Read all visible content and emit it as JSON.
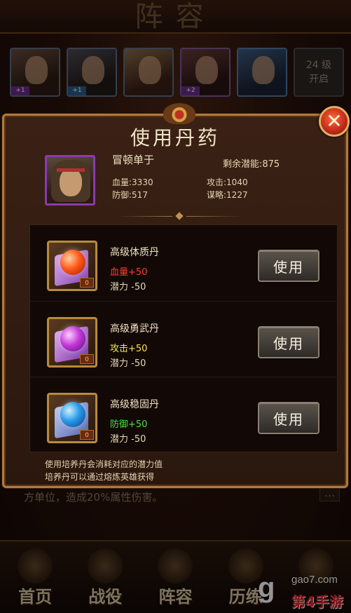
{
  "background": {
    "title": "阵容",
    "locked_slot": {
      "level": "24 级",
      "text": "开启"
    },
    "hero_badges": [
      "+1",
      "+1",
      "",
      "+2",
      ""
    ],
    "skill_desc": "方单位，造成20%属性伤害。",
    "nav": [
      {
        "label": "首页",
        "icon": "palace-icon"
      },
      {
        "label": "战役",
        "icon": "crossed-swords-icon"
      },
      {
        "label": "阵容",
        "icon": "formation-icon"
      },
      {
        "label": "历练",
        "icon": "taiji-icon"
      },
      {
        "label": "",
        "icon": "bag-icon"
      }
    ],
    "watermark": {
      "url": "gao7.com",
      "brand": "第4手游",
      "logo": "g"
    }
  },
  "dialog": {
    "title": "使用丹药",
    "hero": {
      "name": "冒顿单于",
      "remaining_potential": "剩余潜能:875",
      "hp": "血量:3330",
      "attack": "攻击:1040",
      "defense": "防御:517",
      "strategy": "谋略:1227"
    },
    "pills": [
      {
        "name": "高级体质丹",
        "stat": "血量",
        "gain": "+50",
        "cost": "潜力 -50",
        "count": "0",
        "button": "使用",
        "color": "#ff3b2a",
        "orb": "#ff5a1a"
      },
      {
        "name": "高级勇武丹",
        "stat": "攻击",
        "gain": "+50",
        "cost": "潜力 -50",
        "count": "0",
        "button": "使用",
        "color": "#ffe14a",
        "orb": "#c43ad8"
      },
      {
        "name": "高级稳固丹",
        "stat": "防御",
        "gain": "+50",
        "cost": "潜力 -50",
        "count": "0",
        "button": "使用",
        "color": "#49e23a",
        "orb": "#2a9ae8"
      }
    ],
    "notes": [
      "使用培养丹会消耗对应的潜力值",
      "培养丹可以通过熔炼英雄获得"
    ]
  }
}
